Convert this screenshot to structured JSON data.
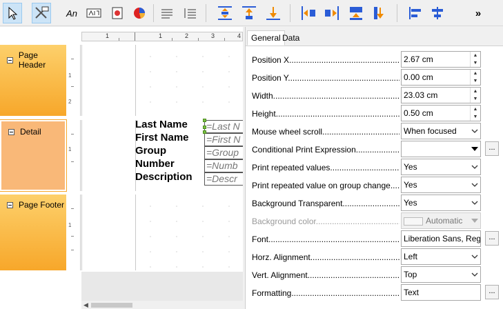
{
  "toolbar": {
    "text_tool_label": "An",
    "more_label": "»"
  },
  "ruler": {
    "ticks": [
      "1",
      "1",
      "2",
      "3",
      "4"
    ],
    "side_ticks": [
      "1",
      "2",
      "1",
      "1"
    ]
  },
  "bands": [
    {
      "name": "Page Header"
    },
    {
      "name": "Detail"
    },
    {
      "name": "Page Footer"
    }
  ],
  "detail": {
    "labels": [
      "Last Name",
      "First Name",
      "Group",
      "Number",
      "Description"
    ],
    "fields": [
      "=Last N",
      "=First N",
      "=Group",
      "=Numb",
      "=Descr"
    ]
  },
  "tabs": [
    {
      "label": "General",
      "active": true
    },
    {
      "label": "Data",
      "active": false
    }
  ],
  "properties": [
    {
      "label": "Position X......................................................",
      "value": "2.67 cm",
      "type": "spin"
    },
    {
      "label": "Position Y......................................................",
      "value": "0.00 cm",
      "type": "spin"
    },
    {
      "label": "Width...........................................................",
      "value": "23.03 cm",
      "type": "spin"
    },
    {
      "label": "Height..........................................................",
      "value": "0.50 cm",
      "type": "spin"
    },
    {
      "label": "Mouse wheel scroll.........................................",
      "value": "When focused",
      "type": "combo"
    },
    {
      "label": "Conditional Print Expression.........................",
      "value": "",
      "type": "combo-ellipsis"
    },
    {
      "label": "Print repeated values......................................",
      "value": "Yes",
      "type": "combo"
    },
    {
      "label": "Print repeated value on group change.........",
      "value": "Yes",
      "type": "combo"
    },
    {
      "label": "Background Transparent.............................",
      "value": "Yes",
      "type": "combo"
    },
    {
      "label": "Background color..........................................",
      "value": "Automatic",
      "type": "color"
    },
    {
      "label": "Font................................................................",
      "value": "Liberation Sans, Regu",
      "type": "text-ellipsis"
    },
    {
      "label": "Horz. Alignment................................................",
      "value": "Left",
      "type": "combo"
    },
    {
      "label": "Vert. Alignment.................................................",
      "value": "Top",
      "type": "combo"
    },
    {
      "label": "Formatting.........................................................",
      "value": "Text",
      "type": "text-ellipsis"
    }
  ],
  "ellipsis_label": "...",
  "colors": {
    "band_top": "#fdd06b",
    "band_bottom": "#f7a72a",
    "detail_band": "#f9b878",
    "selection": "#cce4f7",
    "handle": "#7ac142"
  }
}
